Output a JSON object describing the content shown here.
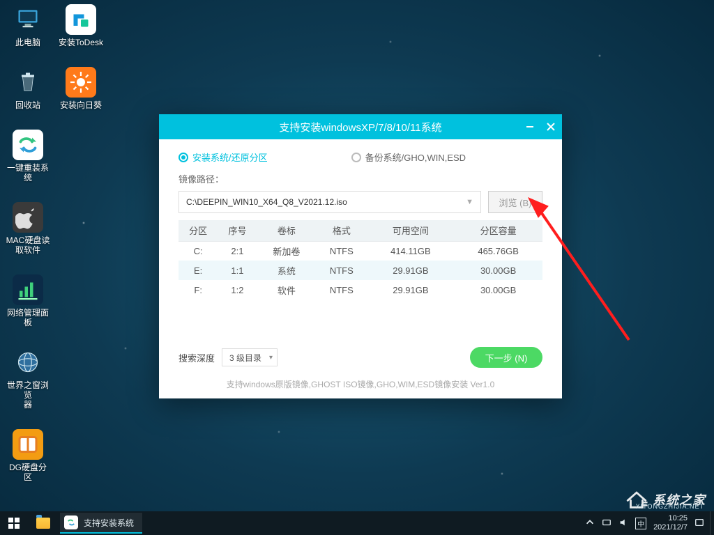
{
  "desktop_icons": {
    "this_pc": "此电脑",
    "todesk": "安装ToDesk",
    "recycle": "回收站",
    "sunflower": "安装向日葵",
    "reinstall": "一键重装系统",
    "macdisk": "MAC硬盘读\n取软件",
    "netpanel": "网络管理面板",
    "world_browser": "世界之窗浏览\n器",
    "dgdisk": "DG硬盘分区"
  },
  "dialog": {
    "title": "支持安装windowsXP/7/8/10/11系统",
    "radio_install": "安装系统/还原分区",
    "radio_backup": "备份系统/GHO,WIN,ESD",
    "path_label": "镜像路径：",
    "path_value": "C:\\DEEPIN_WIN10_X64_Q8_V2021.12.iso",
    "browse": "浏览 (B)",
    "table": {
      "headers": [
        "分区",
        "序号",
        "卷标",
        "格式",
        "可用空间",
        "分区容量"
      ],
      "rows": [
        {
          "part": "C:",
          "idx": "2:1",
          "label": "新加卷",
          "fmt": "NTFS",
          "free": "414.11GB",
          "cap": "465.76GB"
        },
        {
          "part": "E:",
          "idx": "1:1",
          "label": "系统",
          "fmt": "NTFS",
          "free": "29.91GB",
          "cap": "30.00GB"
        },
        {
          "part": "F:",
          "idx": "1:2",
          "label": "软件",
          "fmt": "NTFS",
          "free": "29.91GB",
          "cap": "30.00GB"
        }
      ]
    },
    "search_depth_label": "搜索深度",
    "search_depth_value": "3 级目录",
    "next": "下一步 (N)",
    "footer": "支持windows原版镜像,GHOST ISO镜像,GHO,WIM,ESD镜像安装 Ver1.0"
  },
  "taskbar": {
    "app_title": "支持安装系统",
    "time": "10:25",
    "date": "2021/12/7"
  },
  "watermark": {
    "text": "系统之家",
    "sub": "XITONGZHIJIA.NET"
  }
}
